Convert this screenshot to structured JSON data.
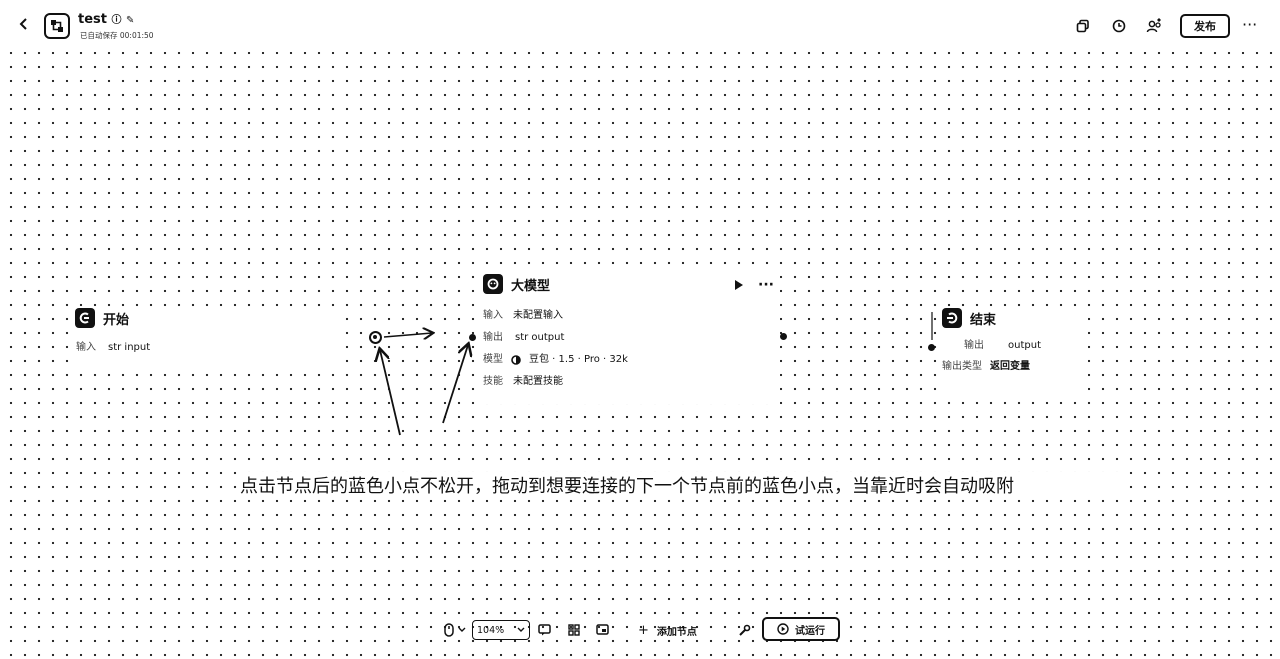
{
  "header": {
    "back_icon": "chevron-left-icon",
    "app_icon": "workflow-icon",
    "title": "test",
    "autosave_text": "已自动保存 00:01:50",
    "publish_label": "发布",
    "more_label": "···"
  },
  "nodes": {
    "start": {
      "title": "开始",
      "icon": "start-icon",
      "rows": [
        {
          "key": "输入",
          "value": "str input"
        }
      ]
    },
    "llm": {
      "title": "大模型",
      "icon": "llm-icon",
      "rows": [
        {
          "key": "输入",
          "value": "未配置输入"
        },
        {
          "key": "输出",
          "value": "str output"
        },
        {
          "key": "模型",
          "value": "豆包 · 1.5 · Pro · 32k"
        },
        {
          "key": "技能",
          "value": "未配置技能"
        }
      ],
      "more_label": "···"
    },
    "end": {
      "title": "结束",
      "icon": "end-icon",
      "rows": [
        {
          "key": "输出",
          "value": "output"
        },
        {
          "key": "输出类型",
          "value": "返回变量"
        }
      ]
    }
  },
  "annotation": "点击节点后的蓝色小点不松开，拖动到想要连接的下一个节点前的蓝色小点，当靠近时会自动吸附",
  "toolbar": {
    "zoom_value": "104%",
    "add_node_label": "添加节点",
    "add_node_prefix": "+",
    "run_label": "试运行"
  }
}
